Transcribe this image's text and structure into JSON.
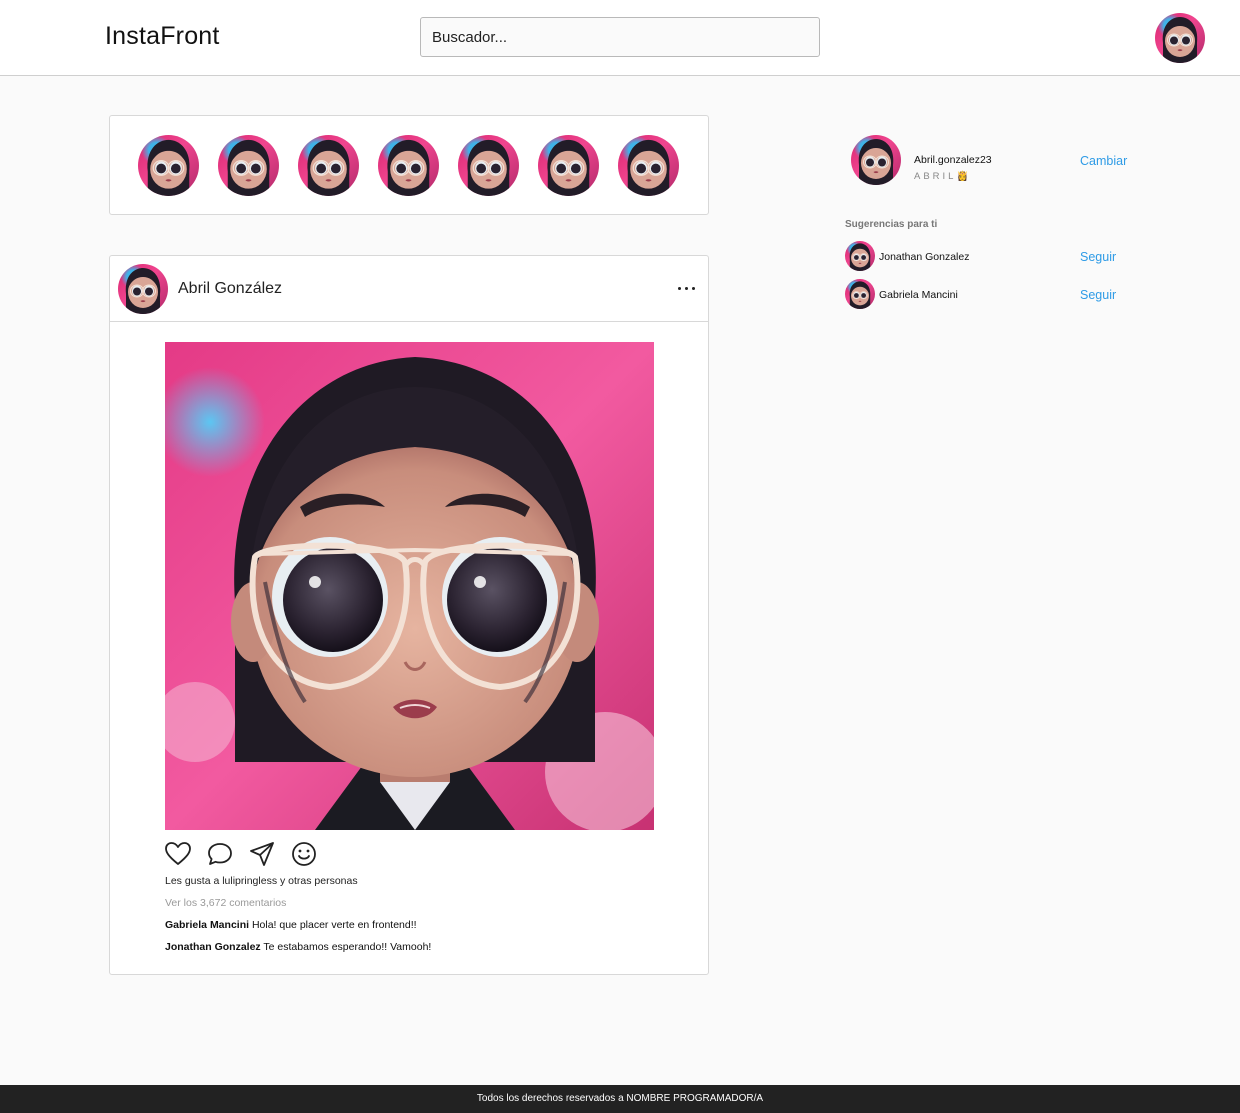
{
  "header": {
    "logo": "InstaFront",
    "search_placeholder": "Buscador..."
  },
  "stories": {
    "count": 7
  },
  "post": {
    "username": "Abril González",
    "likes_text": "Les gusta a lulipringless y otras personas",
    "view_comments": "Ver los 3,672 comentarios",
    "comments": [
      {
        "author": "Gabriela Mancini",
        "text": " Hola! que placer verte en frontend!!"
      },
      {
        "author": "Jonathan Gonzalez",
        "text": " Te estabamos esperando!! Vamooh!"
      }
    ],
    "actions": [
      "heart-icon",
      "comment-icon",
      "send-icon",
      "emoji-icon"
    ]
  },
  "sidebar": {
    "username": "Abril.gonzalez23",
    "display_name": "ABRIL👸",
    "switch_label": "Cambiar",
    "suggestions_title": "Sugerencias para ti",
    "suggestions": [
      {
        "name": "Jonathan Gonzalez",
        "action": "Seguir"
      },
      {
        "name": "Gabriela Mancini",
        "action": "Seguir"
      }
    ]
  },
  "footer": {
    "text": "Todos los derechos reservados a NOMBRE PROGRAMADOR/A"
  },
  "colors": {
    "accent_link": "#2e9be6",
    "footer_bg": "#222222",
    "page_bg": "#fafafa"
  }
}
